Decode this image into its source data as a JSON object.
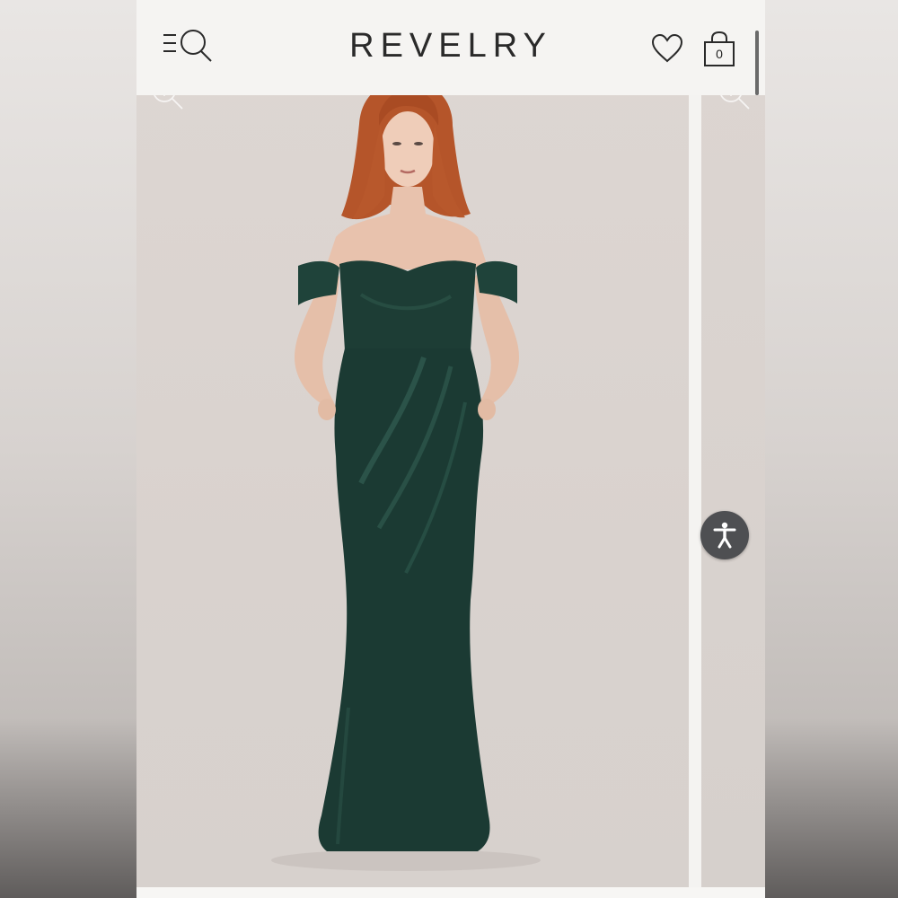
{
  "header": {
    "brand": "REVELRY",
    "cart_count": "0",
    "icons": {
      "menu_search": "menu-search-icon",
      "wishlist": "heart-icon",
      "cart": "shopping-bag-icon"
    }
  },
  "gallery": {
    "main_image": "model-in-off-shoulder-emerald-velvet-gown",
    "next_image": "next-gallery-image-peek",
    "zoom_icon": "zoom-in-icon"
  },
  "accessibility": {
    "icon": "accessibility-icon"
  },
  "colors": {
    "brand_text": "#2a2a2a",
    "dress": "#1d3d35",
    "hair": "#b5552a",
    "backdrop": "#d9d2ce",
    "accessibility_button": "#4e4f52"
  }
}
